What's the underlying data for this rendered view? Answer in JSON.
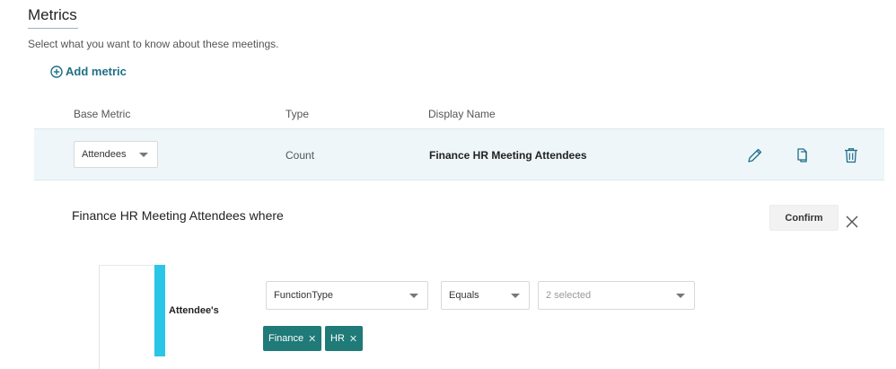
{
  "section": {
    "title": "Metrics",
    "subtitle": "Select what you want to know about these meetings.",
    "add_metric_label": "Add metric"
  },
  "table": {
    "columns": [
      "Base Metric",
      "Type",
      "Display Name"
    ],
    "row": {
      "base_metric": "Attendees",
      "type": "Count",
      "display_name": "Finance HR Meeting Attendees"
    }
  },
  "editor": {
    "heading": "Finance HR Meeting Attendees where",
    "confirm_label": "Confirm",
    "condition": {
      "subject": "Attendee's",
      "field": "FunctionType",
      "operator": "Equals",
      "values_placeholder": "2 selected",
      "chips": [
        "Finance",
        "HR"
      ]
    }
  },
  "colors": {
    "accent": "#1f6f86",
    "row_highlight": "#eef6fa",
    "condition_bar": "#29c6e8",
    "chip_bg": "#1f7a78"
  },
  "icons": [
    "plus-circle-icon",
    "pencil-icon",
    "copy-icon",
    "trash-icon",
    "close-icon",
    "chevron-down-icon"
  ]
}
